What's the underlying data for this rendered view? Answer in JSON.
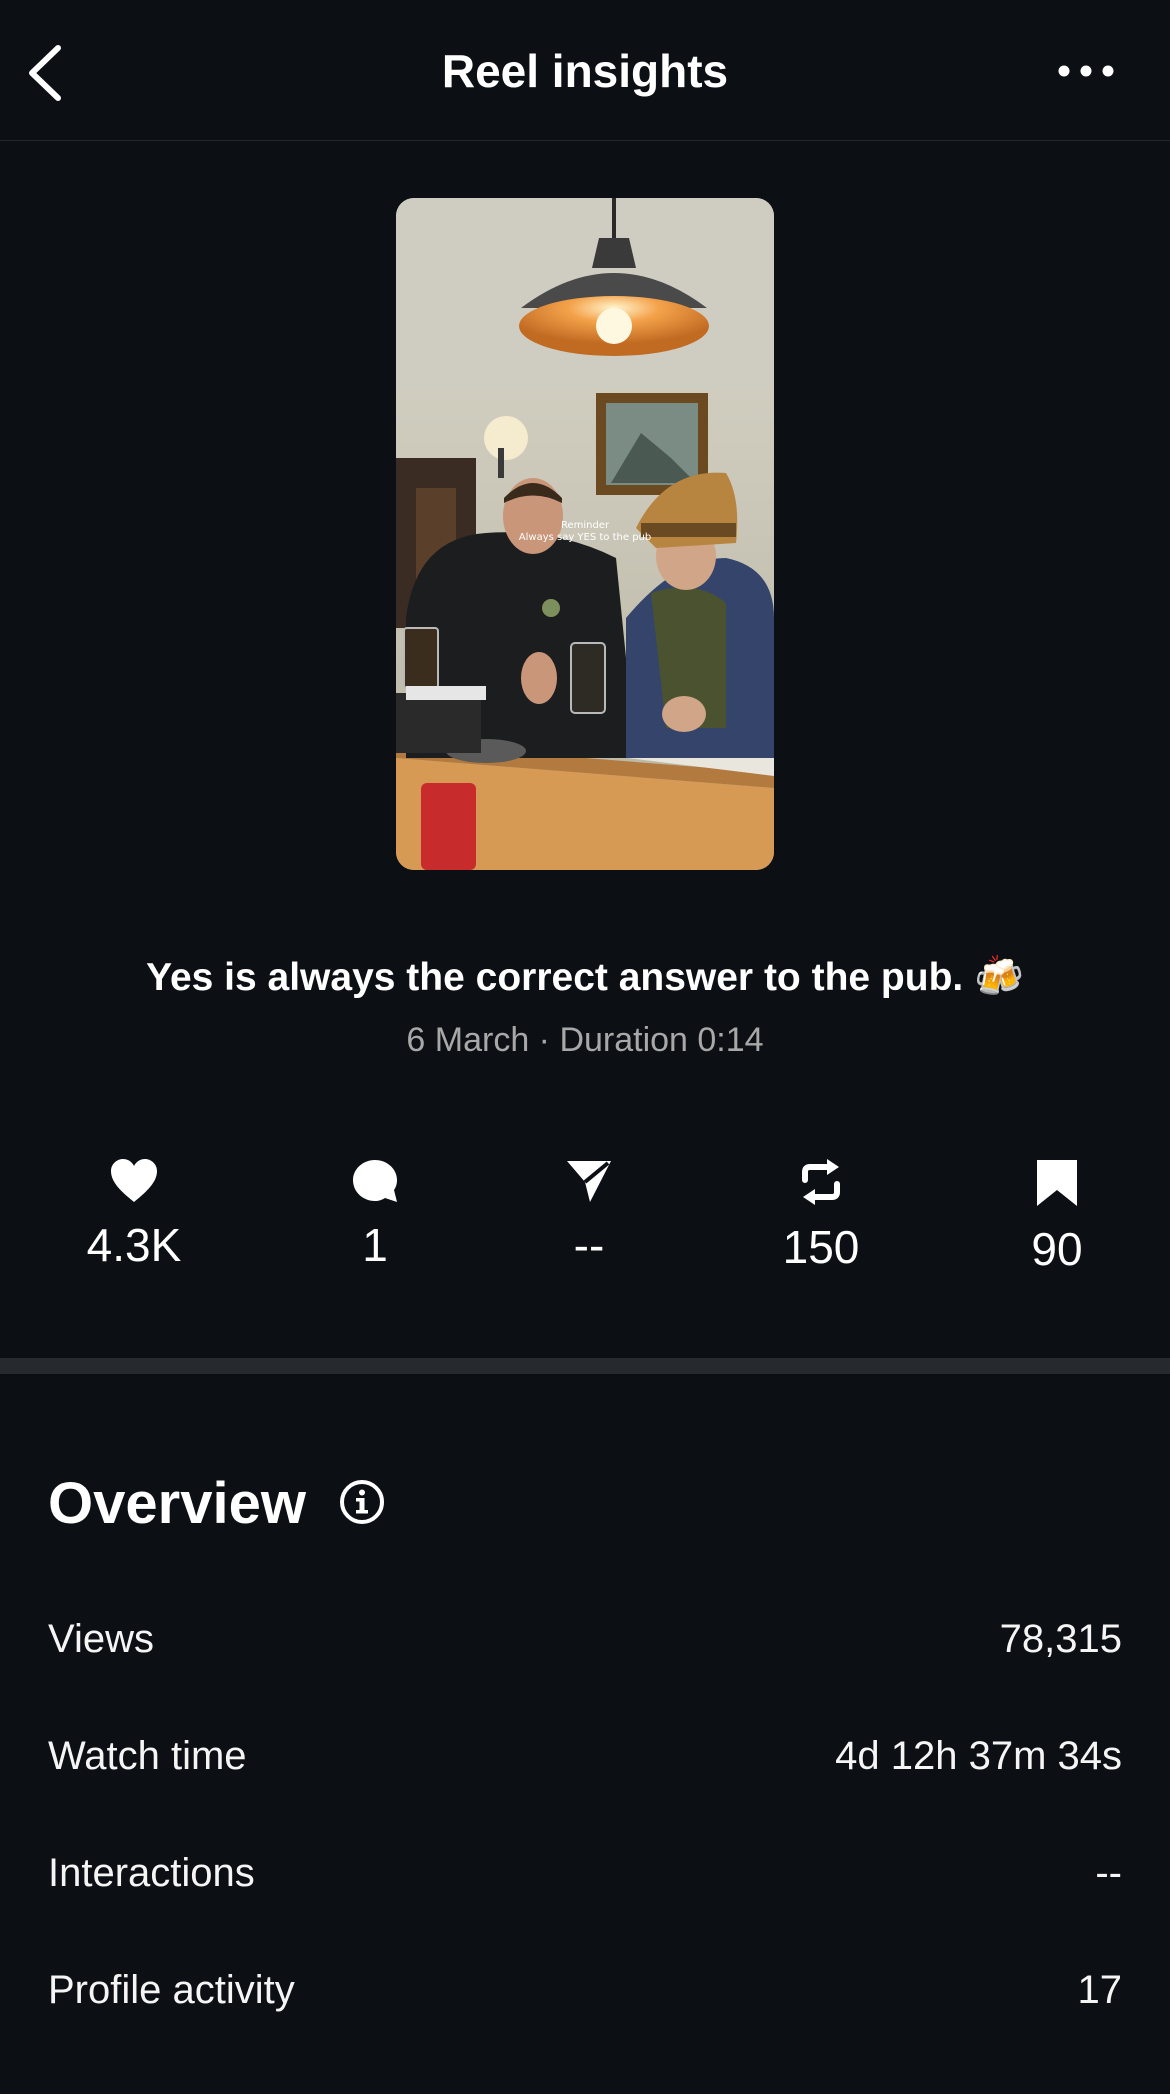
{
  "header": {
    "title": "Reel insights",
    "back_icon": "chevron-left-icon",
    "more_icon": "more-horizontal-icon"
  },
  "reel": {
    "overlay_text_line1": "Reminder",
    "overlay_text_line2": "Always say YES to the pub",
    "caption": "Yes is always the correct answer to the pub.",
    "caption_emoji": "🍻",
    "meta": "6 March · Duration 0:14"
  },
  "stats": [
    {
      "icon": "heart-icon",
      "value": "4.3K"
    },
    {
      "icon": "comment-icon",
      "value": "1"
    },
    {
      "icon": "send-icon",
      "value": "--"
    },
    {
      "icon": "repost-icon",
      "value": "150"
    },
    {
      "icon": "bookmark-icon",
      "value": "90"
    }
  ],
  "overview": {
    "title": "Overview",
    "info_icon": "info-icon",
    "rows": [
      {
        "label": "Views",
        "value": "78,315"
      },
      {
        "label": "Watch time",
        "value": "4d 12h 37m 34s"
      },
      {
        "label": "Interactions",
        "value": "--"
      },
      {
        "label": "Profile activity",
        "value": "17"
      }
    ]
  },
  "colors": {
    "background": "#0c1014",
    "divider": "#262a2f",
    "text": "#f5f5f5",
    "muted": "#a8a8a8"
  }
}
